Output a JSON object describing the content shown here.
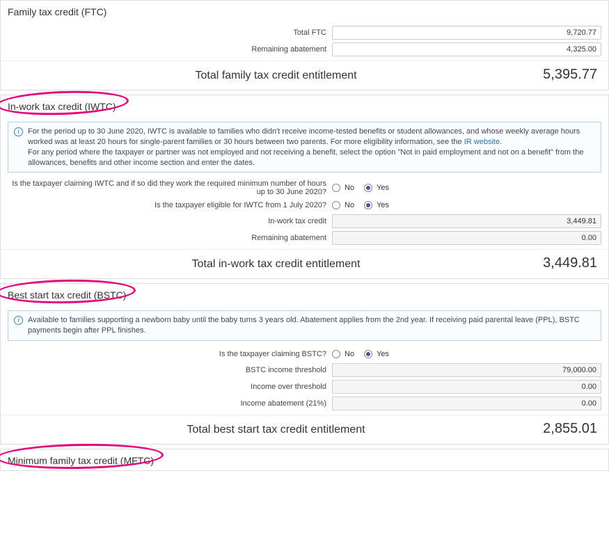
{
  "ftc": {
    "heading": "Family tax credit (FTC)",
    "total_ftc_label": "Total FTC",
    "total_ftc_value": "9,720.77",
    "remaining_abatement_label": "Remaining abatement",
    "remaining_abatement_value": "4,325.00",
    "total_label": "Total family tax credit entitlement",
    "total_value": "5,395.77"
  },
  "iwtc": {
    "heading": "In-work tax credit (IWTC)",
    "info_text_1": "For the period up to 30 June 2020, IWTC is available to families who didn't receive income-tested benefits or student allowances, and whose weekly average hours worked was at least 20 hours for single-parent families or 30 hours between two parents. For more eligibility information, see the ",
    "info_link": "IR website",
    "info_text_2": "For any period where the taxpayer or partner was not employed and not receiving a benefit, select the option \"Not in paid employment and not on a benefit\" from the allowances, benefits and other income section and enter the dates.",
    "q1_label": "Is the taxpayer claiming IWTC and if so did they work the required minimum number of hours up to 30 June 2020?",
    "q2_label": "Is the taxpayer eligible for IWTC from 1 July 2020?",
    "no_label": "No",
    "yes_label": "Yes",
    "iwtc_credit_label": "In-work tax credit",
    "iwtc_credit_value": "3,449.81",
    "remaining_abatement_label": "Remaining abatement",
    "remaining_abatement_value": "0.00",
    "total_label": "Total in-work tax credit entitlement",
    "total_value": "3,449.81"
  },
  "bstc": {
    "heading": "Best start tax credit (BSTC)",
    "info_text": "Available to families supporting a newborn baby until the baby turns 3 years old. Abatement applies from the 2nd year. If receiving paid parental leave (PPL), BSTC payments begin after PPL finishes.",
    "q1_label": "Is the taxpayer claiming BSTC?",
    "no_label": "No",
    "yes_label": "Yes",
    "threshold_label": "BSTC income threshold",
    "threshold_value": "79,000.00",
    "over_label": "Income over threshold",
    "over_value": "0.00",
    "abate_label": "Income abatement (21%)",
    "abate_value": "0.00",
    "total_label": "Total best start tax credit entitlement",
    "total_value": "2,855.01"
  },
  "mftc": {
    "heading": "Minimum family tax credit (MFTC)"
  }
}
